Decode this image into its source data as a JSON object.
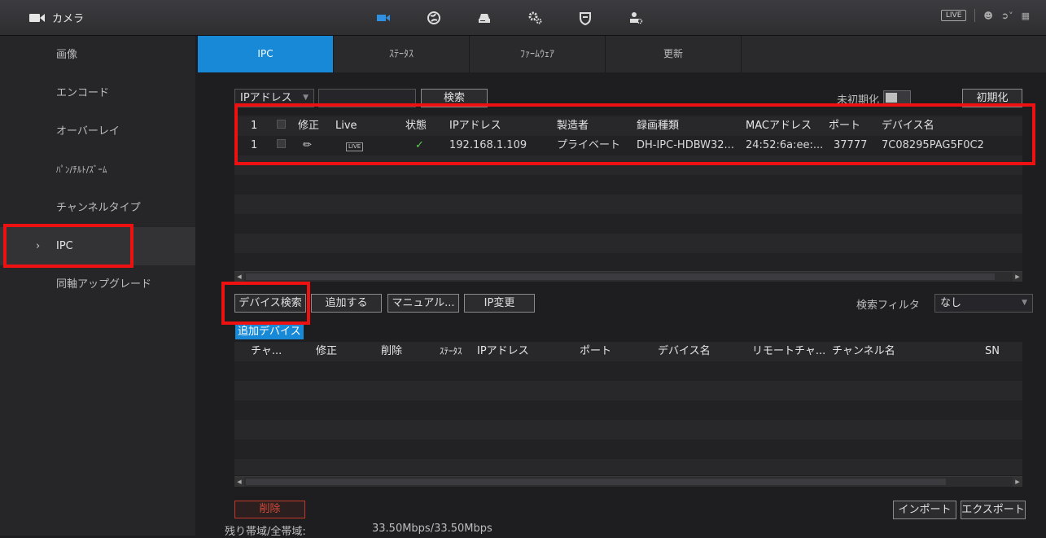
{
  "app": {
    "title": "カメラ"
  },
  "top_nav": {
    "icons": [
      "camera-icon",
      "network-globe-icon",
      "storage-icon",
      "system-gear-icon",
      "security-shield-icon",
      "account-icon"
    ],
    "live_label": "LIVE"
  },
  "sidebar": {
    "items": [
      {
        "label": "画像"
      },
      {
        "label": "エンコード"
      },
      {
        "label": "オーバーレイ"
      },
      {
        "label": "ﾊﾟﾝ/ﾁﾙﾄ/ｽﾞｰﾑ"
      },
      {
        "label": "チャンネルタイプ"
      },
      {
        "label": "IPC",
        "active": true
      },
      {
        "label": "同軸アップグレード"
      }
    ]
  },
  "tabs": [
    {
      "label": "IPC",
      "active": true
    },
    {
      "label": "ｽﾃｰﾀｽ"
    },
    {
      "label": "ﾌｧｰﾑｳｪｱ"
    },
    {
      "label": "更新"
    }
  ],
  "filter": {
    "type_select": "IPアドレス",
    "search_value": "",
    "search_button": "検索",
    "uninit_label": "未初期化",
    "init_button": "初期化"
  },
  "added_table": {
    "headers": [
      "",
      "",
      "修正",
      "Live",
      "状態",
      "IPアドレス",
      "製造者",
      "録画種類",
      "MACアドレス",
      "ポート",
      "デバイス名"
    ],
    "rows": [
      {
        "no": "1",
        "live": "LIVE",
        "status": "✓",
        "ip": "192.168.1.109",
        "maker": "プライベート",
        "type": "DH-IPC-HDBW32...",
        "mac": "24:52:6a:ee:...",
        "port": "37777",
        "name": "7C08295PAG5F0C2"
      }
    ],
    "header_no": "1"
  },
  "actions": {
    "device_search": "デバイス検索",
    "add": "追加する",
    "manual": "マニュアル...",
    "ip_change": "IP変更",
    "filter_label": "検索フィルタ",
    "filter_value": "なし"
  },
  "found_table": {
    "badge": "追加デバイス",
    "headers": [
      "チャ...",
      "修正",
      "削除",
      "ｽﾃｰﾀｽ",
      "IPアドレス",
      "ポート",
      "デバイス名",
      "リモートチャ...",
      "チャンネル名",
      "SN"
    ]
  },
  "footer": {
    "delete": "削除",
    "import": "インポート",
    "export": "エクスポート",
    "bandwidth_label": "残り帯域/全帯域:",
    "bandwidth_value": "33.50Mbps/33.50Mbps"
  }
}
